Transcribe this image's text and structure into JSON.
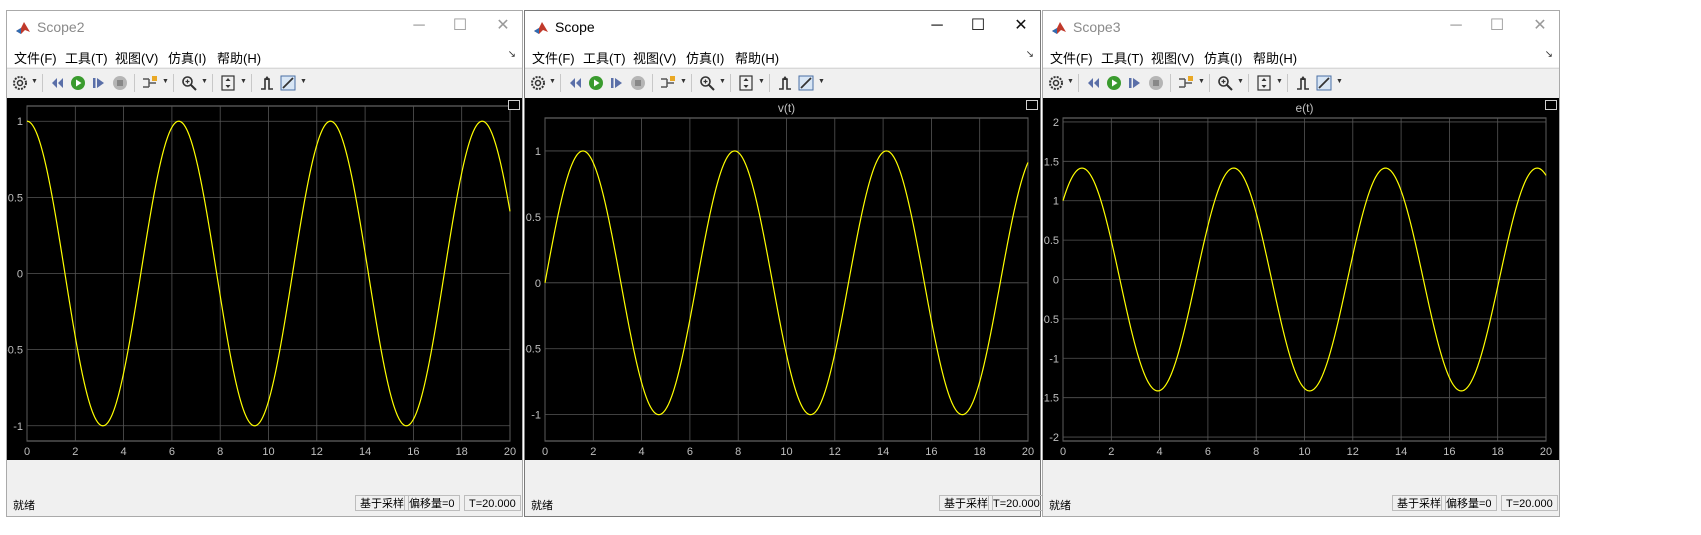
{
  "menus": [
    "文件(F)",
    "工具(T)",
    "视图(V)",
    "仿真(I)",
    "帮助(H)"
  ],
  "toolbar_icons": [
    "settings-icon",
    "step-back-icon",
    "run-icon",
    "step-forward-icon",
    "stop-icon",
    "highlight-icon",
    "zoom-icon",
    "autoscale-icon",
    "trigger-icon",
    "measure-icon"
  ],
  "colors": {
    "trace": "#ffff00",
    "grid": "#555555",
    "axis_text": "#bfbfbf",
    "background": "#000000"
  },
  "windows": [
    {
      "title": "Scope2",
      "active": false,
      "status": {
        "left": "就绪",
        "mode": "基于采样",
        "offset": "偏移量=0",
        "time": "T=20.000"
      },
      "chart_data": {
        "type": "line",
        "title": "",
        "xlim": [
          0,
          20
        ],
        "ylim": [
          -1.1,
          1.1
        ],
        "x_ticks": [
          "0",
          "2",
          "4",
          "6",
          "8",
          "10",
          "12",
          "14",
          "16",
          "18",
          "20"
        ],
        "y_ticks": [
          "1",
          "0.5",
          "0",
          "-0.5",
          "-1"
        ],
        "y_tick_values": [
          1,
          0.5,
          0,
          -0.5,
          -1
        ],
        "series": [
          {
            "formula": "y = cos(t)",
            "amplitude": 1,
            "omega": 1,
            "kind": "cos"
          }
        ],
        "grid": true
      }
    },
    {
      "title": "Scope",
      "active": true,
      "status": {
        "left": "就绪",
        "mode": "基于采样",
        "offset": "",
        "time": "T=20.000"
      },
      "chart_data": {
        "type": "line",
        "title": "v(t)",
        "xlim": [
          0,
          20
        ],
        "ylim": [
          -1.2,
          1.25
        ],
        "x_ticks": [
          "0",
          "2",
          "4",
          "6",
          "8",
          "10",
          "12",
          "14",
          "16",
          "18",
          "20"
        ],
        "y_ticks": [
          "1",
          "0.5",
          "0",
          "-0.5",
          "-1"
        ],
        "y_tick_values": [
          1,
          0.5,
          0,
          -0.5,
          -1
        ],
        "series": [
          {
            "formula": "y = sin(t)",
            "amplitude": 1,
            "omega": 1,
            "kind": "sin"
          }
        ],
        "grid": true
      }
    },
    {
      "title": "Scope3",
      "active": false,
      "status": {
        "left": "就绪",
        "mode": "基于采样",
        "offset": "偏移量=0",
        "time": "T=20.000"
      },
      "chart_data": {
        "type": "line",
        "title": "e(t)",
        "xlim": [
          0,
          20
        ],
        "ylim": [
          -2.05,
          2.05
        ],
        "x_ticks": [
          "0",
          "2",
          "4",
          "6",
          "8",
          "10",
          "12",
          "14",
          "16",
          "18",
          "20"
        ],
        "y_ticks": [
          "2",
          "1.5",
          "1",
          "0.5",
          "0",
          "-0.5",
          "-1",
          "-1.5",
          "-2"
        ],
        "y_tick_values": [
          2,
          1.5,
          1,
          0.5,
          0,
          -0.5,
          -1,
          -1.5,
          -2
        ],
        "series": [
          {
            "formula": "y = sin(t) + cos(t)",
            "amplitude": 1.65,
            "omega": 1,
            "kind": "sincos"
          }
        ],
        "grid": true
      }
    }
  ]
}
